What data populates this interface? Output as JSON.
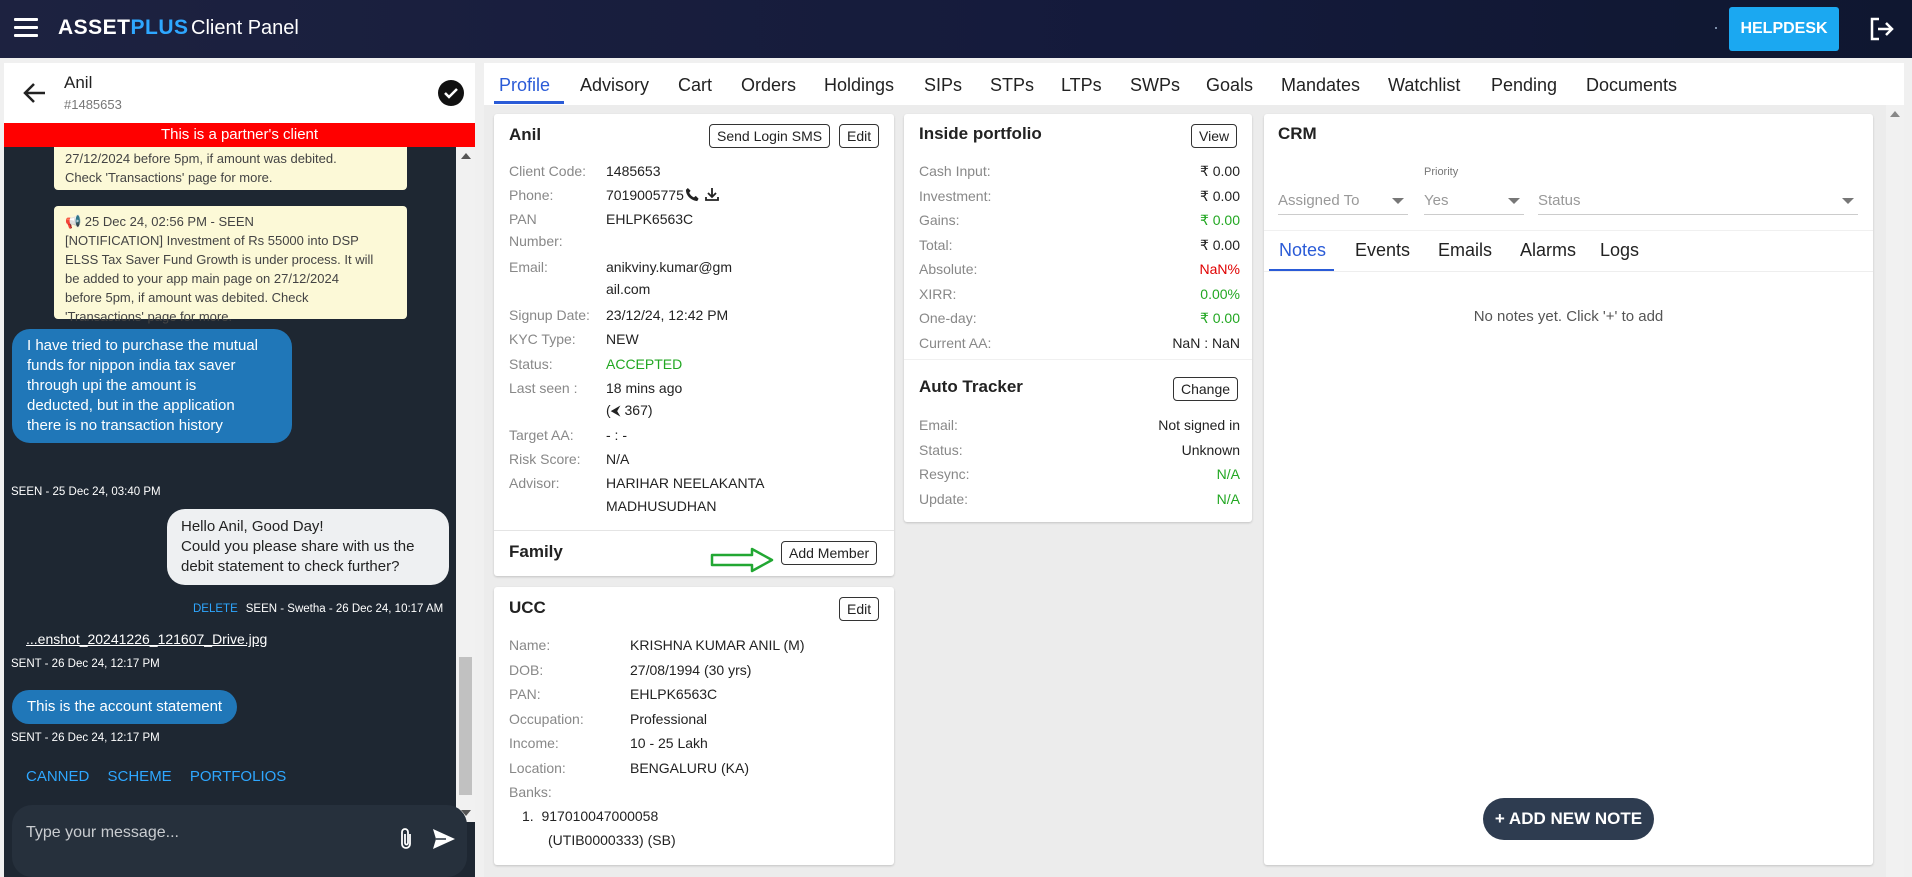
{
  "header": {
    "brand_part1": "ASSET",
    "brand_part2": "PLUS",
    "panel_title": "Client Panel",
    "helpdesk_label": "HELPDESK"
  },
  "chat": {
    "client_name": "Anil",
    "client_id": "#1485653",
    "partner_banner": "This is a partner's client",
    "notification1_line1": "27/12/2024 before 5pm, if amount was debited.",
    "notification1_line2": "Check 'Transactions' page for more.",
    "notification2_line1": "📢 25 Dec 24, 02:56 PM - SEEN",
    "notification2_line2": "[NOTIFICATION] Investment of Rs 55000 into DSP",
    "notification2_line3": "ELSS Tax Saver Fund Growth is under process. It will",
    "notification2_line4": "be added to your app main page on 27/12/2024",
    "notification2_line5": "before 5pm, if amount was debited. Check",
    "notification2_line6": "'Transactions' page for more.",
    "client_msg_line1": "I have tried to purchase the mutual",
    "client_msg_line2": "funds for nippon india tax saver",
    "client_msg_line3": "through upi the amount is",
    "client_msg_line4": "deducted, but in the application",
    "client_msg_line5": "there is no transaction history",
    "client_msg_meta": "SEEN - 25 Dec 24, 03:40 PM",
    "agent_msg_line1": "Hello Anil, Good Day!",
    "agent_msg_line2": "Could you please share with us the",
    "agent_msg_line3": "debit statement to check further?",
    "agent_delete": "DELETE",
    "agent_msg_meta": "SEEN - Swetha - 26 Dec 24, 10:17 AM",
    "attachment_name": "...enshot_20241226_121607_Drive.jpg",
    "attachment_meta": "SENT - 26 Dec 24, 12:17 PM",
    "statement_msg": "This is the account statement",
    "statement_meta": "SENT - 26 Dec 24, 12:17 PM",
    "quick_links": [
      "CANNED",
      "SCHEME",
      "PORTFOLIOS"
    ],
    "composer_placeholder": "Type your message..."
  },
  "tabs": [
    "Profile",
    "Advisory",
    "Cart",
    "Orders",
    "Holdings",
    "SIPs",
    "STPs",
    "LTPs",
    "SWPs",
    "Goals",
    "Mandates",
    "Watchlist",
    "Pending",
    "Documents"
  ],
  "profile": {
    "name": "Anil",
    "send_sms_label": "Send Login SMS",
    "edit_label": "Edit",
    "labels": {
      "client_code": "Client Code:",
      "phone": "Phone:",
      "pan1": "PAN",
      "pan2": "Number:",
      "email": "Email:",
      "signup": "Signup Date:",
      "kyc": "KYC Type:",
      "status": "Status:",
      "last_seen": "Last seen :",
      "target_aa": "Target AA:",
      "risk": "Risk Score:",
      "advisor": "Advisor:"
    },
    "values": {
      "client_code": "1485653",
      "phone": "7019005775",
      "pan": "EHLPK6563C",
      "email1": "anikviny.kumar@gm",
      "email2": "ail.com",
      "signup": "23/12/24, 12:42 PM",
      "kyc": "NEW",
      "status": "ACCEPTED",
      "last_seen1": "18 mins ago",
      "last_seen2": "(⮜ 367)",
      "target_aa": "- : -",
      "risk": "N/A",
      "advisor1": "HARIHAR NEELAKANTA",
      "advisor2": "MADHUSUDHAN"
    },
    "family_title": "Family",
    "add_member_label": "Add Member"
  },
  "ucc": {
    "title": "UCC",
    "edit_label": "Edit",
    "labels": {
      "name": "Name:",
      "dob": "DOB:",
      "pan": "PAN:",
      "occupation": "Occupation:",
      "income": "Income:",
      "location": "Location:",
      "banks": "Banks:"
    },
    "values": {
      "name": "KRISHNA KUMAR ANIL (M)",
      "dob": "27/08/1994 (30 yrs)",
      "pan": "EHLPK6563C",
      "occupation": "Professional",
      "income": "10 - 25 Lakh",
      "location": "BENGALURU (KA)"
    },
    "bank_line1": "1.  917010047000058",
    "bank_line2": "(UTIB0000333) (SB)"
  },
  "portfolio": {
    "title": "Inside portfolio",
    "view_label": "View",
    "rows": [
      {
        "label": "Cash Input:",
        "value": "₹ 0.00",
        "color": "#222222"
      },
      {
        "label": "Investment:",
        "value": "₹ 0.00",
        "color": "#222222"
      },
      {
        "label": "Gains:",
        "value": "₹ 0.00",
        "color": "#22a722"
      },
      {
        "label": "Total:",
        "value": "₹ 0.00",
        "color": "#222222"
      },
      {
        "label": "Absolute:",
        "value": "NaN%",
        "color": "#e00000"
      },
      {
        "label": "XIRR:",
        "value": "0.00%",
        "color": "#22a722"
      },
      {
        "label": "One-day:",
        "value": "₹ 0.00",
        "color": "#22a722"
      },
      {
        "label": "Current AA:",
        "value": "NaN : NaN",
        "color": "#222222"
      }
    ]
  },
  "tracker": {
    "title": "Auto Tracker",
    "change_label": "Change",
    "rows": [
      {
        "label": "Email:",
        "value": "Not signed in",
        "color": "#222222"
      },
      {
        "label": "Status:",
        "value": "Unknown",
        "color": "#222222"
      },
      {
        "label": "Resync:",
        "value": "N/A",
        "color": "#22a722"
      },
      {
        "label": "Update:",
        "value": "N/A",
        "color": "#22a722"
      }
    ]
  },
  "crm": {
    "title": "CRM",
    "priority_label": "Priority",
    "assigned_to": "Assigned To",
    "priority_value": "Yes",
    "status": "Status",
    "tabs": [
      "Notes",
      "Events",
      "Emails",
      "Alarms",
      "Logs"
    ],
    "empty_text": "No notes yet. Click '+' to add",
    "add_note_label": "+ ADD NEW NOTE"
  }
}
